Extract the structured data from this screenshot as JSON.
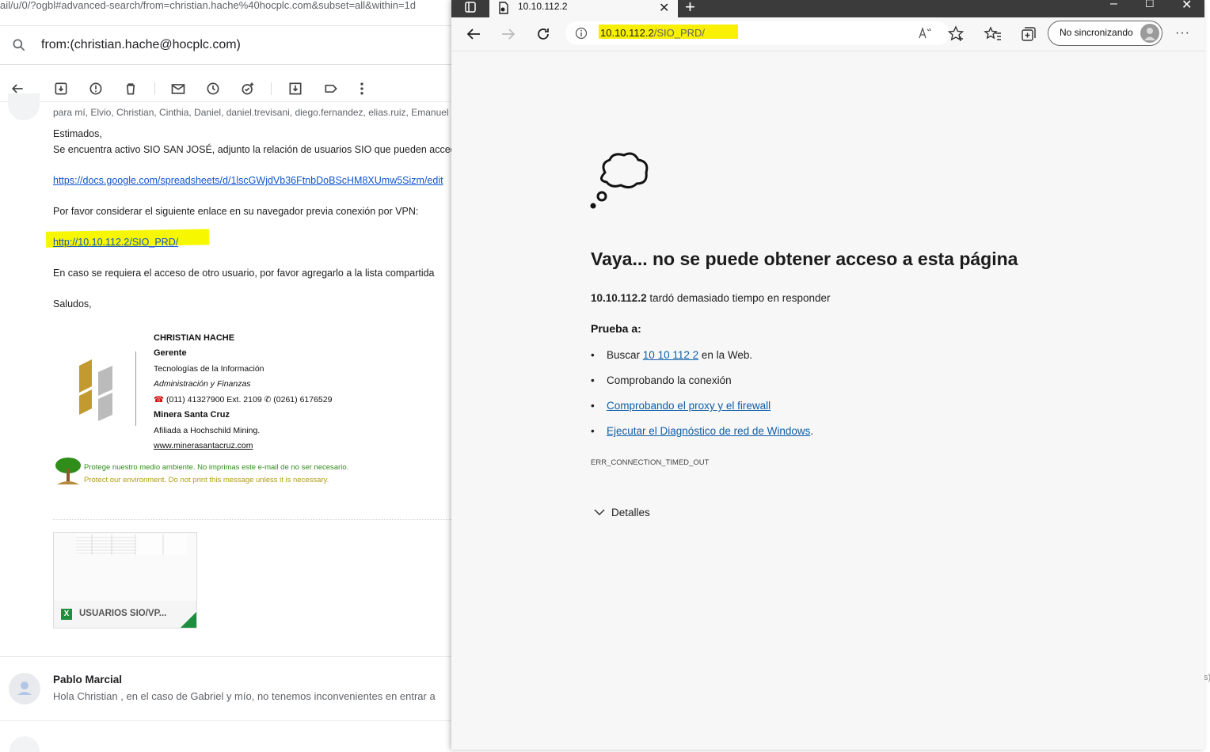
{
  "gmail": {
    "url_fragment": "ail/u/0/?ogbl#advanced-search/from=christian.hache%40hocplc.com&subset=all&within=1d",
    "search_query": "from:(christian.hache@hocplc.com)",
    "recipients": "para mí, Elvio, Christian, Cinthia, Daniel, daniel.trevisani, diego.fernandez, elias.ruiz, Emanuel",
    "body": {
      "greeting": "Estimados,",
      "line1": "Se encuentra activo  SIO SAN JOSÉ, adjunto la relación de usuarios SIO que pueden acceder",
      "sheet_link": "https://docs.google.com/spreadsheets/d/1lscGWjdVb36FtnbDoBScHM8XUmw5Sizm/edit",
      "line2": "Por favor considerar el siguiente enlace en su navegador previa conexión por VPN:",
      "vpn_link": "http://10.10.112.2/SIO_PRD/",
      "line3": "En caso se requiera el acceso de otro usuario, por favor agregarlo a la lista compartida",
      "closing": "Saludos,"
    },
    "signature": {
      "name": "CHRISTIAN HACHE",
      "role": "Gerente",
      "dept": "Tecnologías de la Información",
      "area": "Administración y Finanzas",
      "phones": "(011) 41327900 Ext. 2109 ✆ (0261) 6176529",
      "company": "Minera Santa Cruz",
      "affiliation": "Afiliada a Hochschild Mining.",
      "website": "www.minerasantacruz.com",
      "eco_es": "Protege nuestro medio ambiente. No imprimas este e-mail de no ser necesario.",
      "eco_en": "Protect our environment. Do not print this message unless it is necessary."
    },
    "attachment": {
      "name": "USUARIOS SIO/VP...",
      "type_badge": "X"
    },
    "next_message": {
      "sender": "Pablo Marcial",
      "snippet": "Hola Christian , en el caso de Gabriel y mío, no tenemos inconvenientes en entrar a"
    },
    "right_edge_stub": "s)"
  },
  "edge": {
    "tab_title": "10.10.112.2",
    "address": {
      "host": "10.10.112.2",
      "path": "/SIO_PRD/"
    },
    "profile_label": "No sincronizando",
    "error": {
      "title": "Vaya... no se puede obtener acceso a esta página",
      "host_bold": "10.10.112.2",
      "host_message": "tardó demasiado tiempo en responder",
      "try_heading": "Prueba a:",
      "item1_prefix": "Buscar",
      "item1_link": "10 10 112 2",
      "item1_suffix": "en la Web.",
      "item2": "Comprobando la conexión",
      "item3_link": "Comprobando el proxy y el firewall",
      "item4_link": "Ejecutar el Diagnóstico de red de Windows",
      "item4_suffix": ".",
      "code": "ERR_CONNECTION_TIMED_OUT",
      "details_label": "Detalles"
    }
  }
}
